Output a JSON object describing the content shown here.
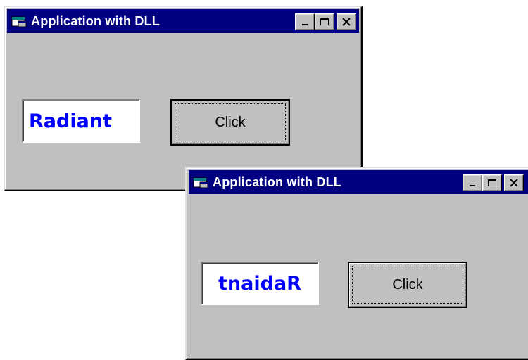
{
  "window1": {
    "title": "Application with DLL",
    "textbox_value": "Radiant",
    "button_label": "Click"
  },
  "window2": {
    "title": "Application with DLL",
    "textbox_value": "tnaidaR",
    "button_label": "Click"
  },
  "colors": {
    "titlebar": "#000080",
    "window_face": "#c0c0c0",
    "text_accent": "#0000ff"
  },
  "icons": [
    "app-icon",
    "minimize-icon",
    "maximize-icon",
    "close-icon"
  ]
}
